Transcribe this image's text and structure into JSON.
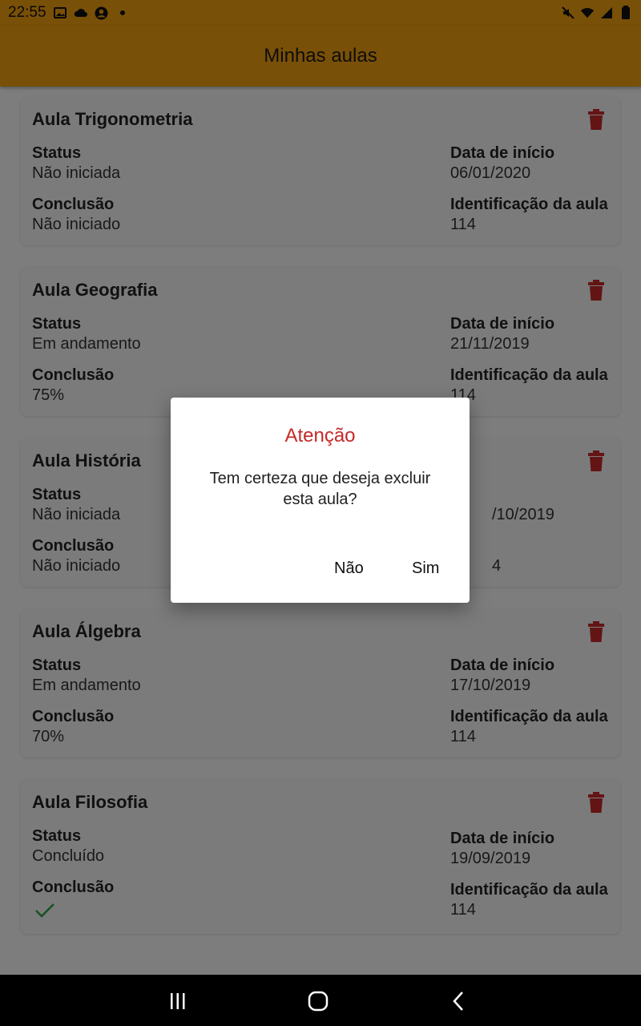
{
  "status_bar": {
    "time": "22:55",
    "icons_left": [
      "image-icon",
      "cloud-icon",
      "account-circle-icon",
      "dot-icon"
    ],
    "icons_right": [
      "mute-icon",
      "wifi-icon",
      "signal-icon",
      "battery-icon"
    ]
  },
  "app_bar": {
    "title": "Minhas aulas",
    "color": "#f3a00f"
  },
  "labels": {
    "status": "Status",
    "conclusion": "Conclusão",
    "start_date": "Data de início",
    "class_id": "Identificação da aula"
  },
  "cards": [
    {
      "title": "Aula Trigonometria",
      "status": "Não iniciada",
      "conclusion": "Não iniciado",
      "start_date": "06/01/2020",
      "class_id": "114"
    },
    {
      "title": "Aula Geografia",
      "status": "Em andamento",
      "conclusion": "75%",
      "start_date": "21/11/2019",
      "class_id": "114"
    },
    {
      "title": "Aula História",
      "status": "Não iniciada",
      "conclusion": "Não iniciado",
      "start_date": "/10/2019",
      "class_id": "4"
    },
    {
      "title": "Aula Álgebra",
      "status": "Em andamento",
      "conclusion": "70%",
      "start_date": "17/10/2019",
      "class_id": "114"
    },
    {
      "title": "Aula Filosofia",
      "status": "Concluído",
      "conclusion_icon": "check-icon",
      "start_date": "19/09/2019",
      "class_id": "114"
    }
  ],
  "dialog": {
    "title": "Atenção",
    "message": "Tem certeza que deseja excluir esta aula?",
    "cancel_label": "Não",
    "confirm_label": "Sim",
    "title_color": "#c62828"
  },
  "nav_bar": {
    "icons": [
      "recent-apps-icon",
      "home-icon",
      "back-icon"
    ]
  },
  "colors": {
    "accent": "#f3a00f",
    "delete": "#c62828",
    "done": "#2e9e46"
  }
}
